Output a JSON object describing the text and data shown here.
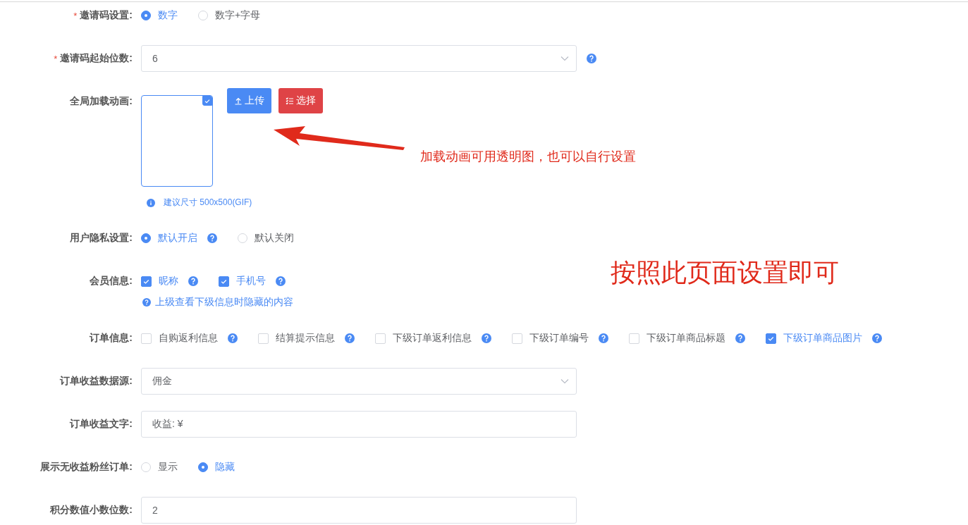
{
  "form": [
    {
      "kind": "radio",
      "label": "邀请码设置:",
      "required": "*",
      "options": [
        {
          "label": "数字",
          "selected": true,
          "help": false
        },
        {
          "label": "数字+字母",
          "selected": false,
          "help": false
        }
      ]
    },
    {
      "kind": "select",
      "label": "邀请码起始位数:",
      "required": "*",
      "value": "6",
      "help": true
    },
    {
      "kind": "upload",
      "label": "全局加载动画:",
      "image_checked": true,
      "buttons": [
        {
          "label": "上传",
          "kind": "upload",
          "color": "#4a8af4"
        },
        {
          "label": "选择",
          "kind": "choose",
          "color": "#df4346"
        }
      ],
      "hint": "建议尺寸 500x500(GIF)"
    },
    {
      "kind": "radio",
      "label": "用户隐私设置:",
      "options": [
        {
          "label": "默认开启",
          "selected": true,
          "help": true
        },
        {
          "label": "默认关闭",
          "selected": false,
          "help": false
        }
      ]
    },
    {
      "kind": "checkbox",
      "label": "会员信息:",
      "options": [
        {
          "label": "昵称",
          "checked": true,
          "help": true
        },
        {
          "label": "手机号",
          "checked": true,
          "help": true
        }
      ],
      "note": "上级查看下级信息时隐藏的内容"
    },
    {
      "kind": "checkbox",
      "label": "订单信息:",
      "options": [
        {
          "label": "自购返利信息",
          "checked": false,
          "help": true
        },
        {
          "label": "结算提示信息",
          "checked": false,
          "help": true
        },
        {
          "label": "下级订单返利信息",
          "checked": false,
          "help": true
        },
        {
          "label": "下级订单编号",
          "checked": false,
          "help": true
        },
        {
          "label": "下级订单商品标题",
          "checked": false,
          "help": true
        },
        {
          "label": "下级订单商品图片",
          "checked": true,
          "help": true
        }
      ]
    },
    {
      "kind": "select",
      "label": "订单收益数据源:",
      "value": "佣金",
      "help": false
    },
    {
      "kind": "input",
      "label": "订单收益文字:",
      "value": "收益: ¥"
    },
    {
      "kind": "radio",
      "label": "展示无收益粉丝订单:",
      "options": [
        {
          "label": "显示",
          "selected": false,
          "help": false
        },
        {
          "label": "隐藏",
          "selected": true,
          "help": false
        }
      ]
    },
    {
      "kind": "input",
      "label": "积分数值小数位数:",
      "value": "2"
    }
  ],
  "annotations": [
    {
      "kind": "arrow-note",
      "text": "加载动画可用透明图，也可以自行设置"
    },
    {
      "kind": "big-note",
      "text": "按照此页面设置即可"
    }
  ]
}
